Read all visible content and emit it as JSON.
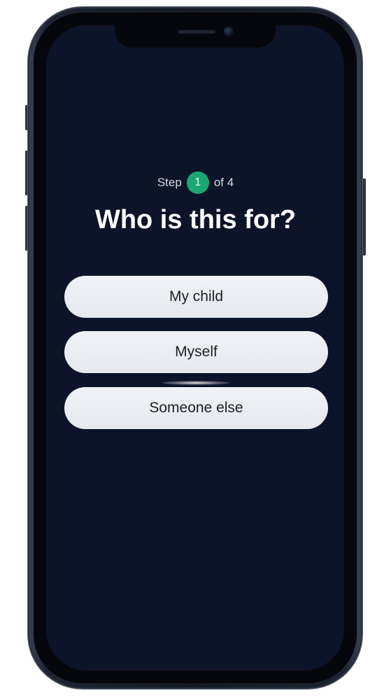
{
  "progress": {
    "prefix": "Step",
    "current": "1",
    "suffix": "of 4",
    "badge_color": "#1aa773"
  },
  "question": {
    "title": "Who is this for?"
  },
  "options": [
    {
      "label": "My child"
    },
    {
      "label": "Myself"
    },
    {
      "label": "Someone else"
    }
  ],
  "theme": {
    "screen_background": "#0c1429",
    "option_background": "#eceef5"
  },
  "device": {
    "icons": [
      "speaker-grille-icon",
      "front-camera-icon"
    ]
  }
}
